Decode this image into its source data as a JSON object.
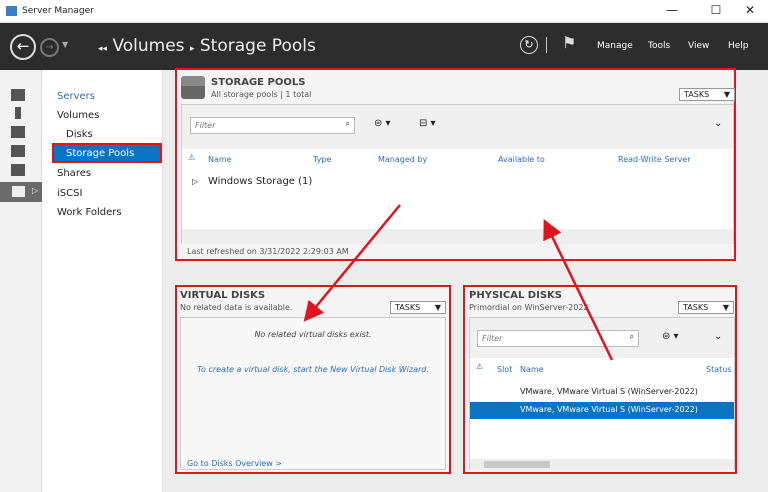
{
  "window": {
    "title": "Server Manager",
    "controls": [
      "—",
      "☐",
      "✕"
    ]
  },
  "header": {
    "breadcrumb_parent": "Volumes",
    "breadcrumb_current": "Storage Pools",
    "menu": [
      "Manage",
      "Tools",
      "View",
      "Help"
    ]
  },
  "nav": {
    "items": [
      "Servers",
      "Volumes",
      "Disks",
      "Storage Pools",
      "Shares",
      "iSCSI",
      "Work Folders"
    ],
    "selected": "Storage Pools"
  },
  "storage_pools": {
    "title": "STORAGE POOLS",
    "subtitle": "All storage pools | 1 total",
    "tasks": "TASKS",
    "filter_placeholder": "Filter",
    "columns": [
      "Name",
      "Type",
      "Managed by",
      "Available to",
      "Read-Write Server"
    ],
    "group": "Windows Storage (1)",
    "footer": "Last refreshed on 3/31/2022 2:29:03 AM"
  },
  "virtual_disks": {
    "title": "VIRTUAL DISKS",
    "subtitle": "No related data is available.",
    "tasks": "TASKS",
    "empty": "No related virtual disks exist.",
    "wizard_link": "To create a virtual disk, start the New Virtual Disk Wizard.",
    "footer_link": "Go to Disks Overview >"
  },
  "physical_disks": {
    "title": "PHYSICAL DISKS",
    "subtitle": "Primordial on WinServer-2022",
    "tasks": "TASKS",
    "filter_placeholder": "Filter",
    "columns": [
      "Slot",
      "Name",
      "Status"
    ],
    "rows": [
      "VMware, VMware Virtual S (WinServer-2022)",
      "VMware, VMware Virtual S (WinServer-2022)"
    ],
    "selected_row": 1
  },
  "colors": {
    "accent": "#0a74c4",
    "highlight": "#e0141e",
    "header": "#2d2d2d"
  }
}
